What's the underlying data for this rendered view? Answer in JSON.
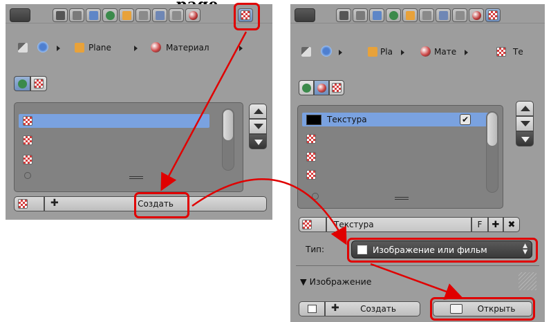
{
  "heading": "page",
  "left_panel": {
    "breadcrumb": {
      "object": "Plane",
      "material": "Материал"
    },
    "texture_slots": [
      "",
      "",
      ""
    ],
    "new_button": "Создать"
  },
  "right_panel": {
    "breadcrumb": {
      "object": "Pla",
      "material": "Мате",
      "texture": "Те"
    },
    "texture_slots": [
      {
        "name": "Текстура",
        "checked": true
      },
      {
        "name": "",
        "checked": false
      },
      {
        "name": "",
        "checked": false
      },
      {
        "name": "",
        "checked": false
      }
    ],
    "texture_name_field": "Текстура",
    "fake_user_label": "F",
    "type_label": "Тип:",
    "type_value": "Изображение или фильм",
    "image_section": "Изображение",
    "new_button": "Создать",
    "open_button": "Открыть"
  },
  "colors": {
    "panel_bg": "#9d9d9d",
    "highlight": "#e00000",
    "selection": "#7aa2e0"
  }
}
